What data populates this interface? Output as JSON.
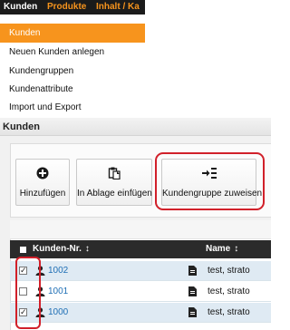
{
  "topnav": {
    "tabs": [
      "Kunden",
      "Produkte",
      "Inhalt / Ka"
    ]
  },
  "menu": {
    "items": [
      "Kunden",
      "Neuen Kunden anlegen",
      "Kundengruppen",
      "Kundenattribute",
      "Import und Export"
    ],
    "active_index": 0
  },
  "section": {
    "title": "Kunden"
  },
  "toolbar": {
    "buttons": [
      {
        "label": "Hinzufügen",
        "icon": "plus-circle-icon"
      },
      {
        "label": "In Ablage einfügen",
        "icon": "clipboard-icon"
      },
      {
        "label": "Kundengruppe zuweisen",
        "icon": "assign-group-icon"
      }
    ]
  },
  "grid": {
    "columns": [
      "Kunden-Nr.",
      "Name"
    ],
    "sort_icon": "sort-arrows-icon",
    "rows": [
      {
        "checked": true,
        "number": "1002",
        "name": "test, strato"
      },
      {
        "checked": false,
        "number": "1001",
        "name": "test, strato"
      },
      {
        "checked": true,
        "number": "1000",
        "name": "test, strato"
      }
    ]
  },
  "colors": {
    "accent": "#f7941d",
    "highlight": "#d1202a",
    "header_bg": "#2b2b2b",
    "link": "#1f6fb5"
  }
}
